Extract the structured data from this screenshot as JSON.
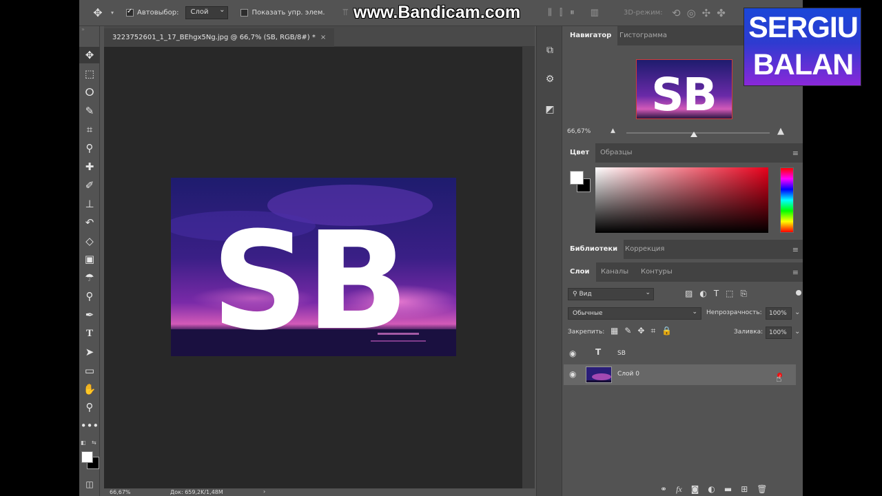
{
  "options_bar": {
    "autoselect_label": "Автовыбор:",
    "autoselect_value": "Слой",
    "show_controls_label": "Показать упр. элем.",
    "watermark": "www.Bandicam.com",
    "mode_3d": "3D-режим:"
  },
  "document": {
    "tab_title": "3223752601_1_17_BEhgx5Ng.jpg @ 66,7% (SB, RGB/8#) *",
    "close": "×",
    "image_text": "SB",
    "status_zoom": "66,67%",
    "status_doc": "Док: 659,2K/1,48M",
    "status_arrow": "›"
  },
  "navigator": {
    "tabs": [
      "Навигатор",
      "Гистограмма"
    ],
    "zoom": "66,67%",
    "zoom_fraction": 0.47
  },
  "color": {
    "tabs": [
      "Цвет",
      "Образцы"
    ],
    "foreground": "#ffffff",
    "background": "#000000"
  },
  "libraries": {
    "tabs": [
      "Библиотеки",
      "Коррекция"
    ]
  },
  "layers": {
    "tabs": [
      "Слои",
      "Каналы",
      "Контуры"
    ],
    "filter_label": "Вид",
    "blend_mode": "Обычные",
    "opacity_label": "Непрозрачность:",
    "opacity_value": "100%",
    "lock_label": "Закрепить:",
    "fill_label": "Заливка:",
    "fill_value": "100%",
    "items": [
      {
        "name": "SB",
        "type_icon": "T"
      },
      {
        "name": "Слой 0"
      }
    ]
  },
  "overlay_logo": {
    "line1": "SERGIU",
    "line2": "BALAN"
  },
  "colors": {
    "panel_bg": "#535353",
    "canvas_bg": "#282828",
    "accent_red": "#d23a3a"
  }
}
